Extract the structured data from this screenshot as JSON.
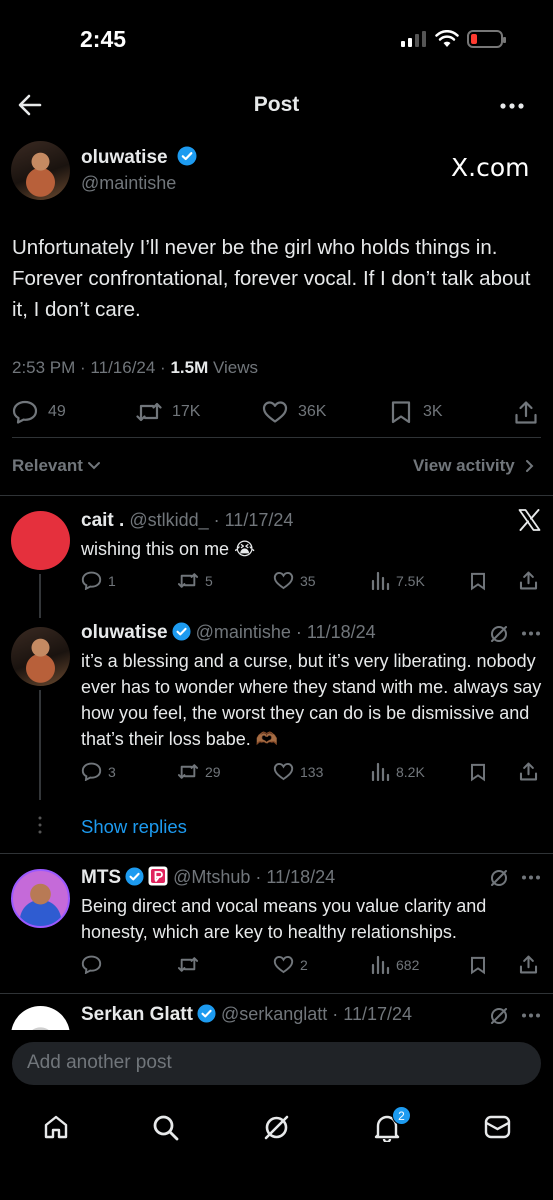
{
  "status_bar": {
    "time": "2:45"
  },
  "header": {
    "title": "Post"
  },
  "post": {
    "author_name": "oluwatise",
    "author_handle": "@maintishe",
    "source_label": "X.com",
    "text": "Unfortunately I’ll never be the girl who holds things in. Forever confrontational, forever vocal. If I don’t talk about it, I don’t care.",
    "meta_time": "2:53 PM · 11/16/24 · ",
    "meta_views_count": "1.5M",
    "meta_views_label": " Views",
    "stats": {
      "replies": "49",
      "reposts": "17K",
      "likes": "36K",
      "bookmarks": "3K"
    }
  },
  "filter": {
    "sort_label": "Relevant",
    "view_activity_label": "View activity"
  },
  "replies": [
    {
      "name": "cait .",
      "handle_date": "@stlkidd_ · 11/17/24",
      "text": "wishing this on me 😭",
      "replies": "1",
      "reposts": "5",
      "likes": "35",
      "views": "7.5K"
    },
    {
      "name": "oluwatise",
      "handle_date": "@maintishe · 11/18/24",
      "text": "it’s a blessing and a curse, but it’s very liberating. nobody ever has to wonder where they stand with me. always say how you feel, the worst they can do is be dismissive and that’s their loss babe. 🫶🏾",
      "replies": "3",
      "reposts": "29",
      "likes": "133",
      "views": "8.2K"
    },
    {
      "name": "MTS",
      "handle_date": "@Mtshub · 11/18/24",
      "text": "Being direct and vocal means you value clarity and honesty, which are key to healthy relationships.",
      "replies": "",
      "reposts": "",
      "likes": "2",
      "views": "682"
    },
    {
      "name": "Serkan Glatt",
      "handle_date": "@serkanglatt · 11/17/24"
    }
  ],
  "show_replies_label": "Show replies",
  "composer": {
    "placeholder": "Add another post"
  },
  "tabbar": {
    "notifications_badge": "2"
  },
  "colors": {
    "accent": "#1d9bf0",
    "background": "#000000",
    "muted": "#71767b",
    "text": "#e7e9ea"
  },
  "icons": [
    "back-arrow-icon",
    "more-icon",
    "verified-icon",
    "x-logo-icon",
    "reply-icon",
    "repost-icon",
    "like-icon",
    "bookmark-icon",
    "share-icon",
    "views-icon",
    "grok-icon",
    "home-icon",
    "search-icon",
    "notifications-icon",
    "messages-icon"
  ]
}
